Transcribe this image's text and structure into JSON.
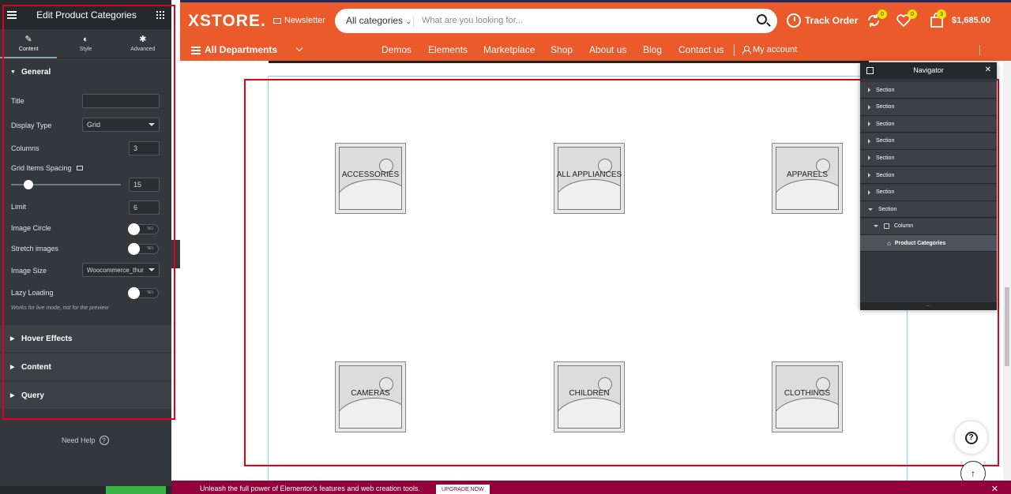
{
  "editor": {
    "title": "Edit Product Categories",
    "tabs": [
      {
        "label": "Content",
        "icon": "pencil-icon"
      },
      {
        "label": "Style",
        "icon": "half-circle-icon"
      },
      {
        "label": "Advanced",
        "icon": "gear-icon"
      }
    ],
    "section_general": "General",
    "controls": {
      "title_label": "Title",
      "title_value": "",
      "display_type_label": "Display Type",
      "display_type_value": "Grid",
      "columns_label": "Columns",
      "columns_value": "3",
      "spacing_label": "Grid Items Spacing",
      "spacing_value": "15",
      "limit_label": "Limit",
      "limit_value": "6",
      "image_circle_label": "Image Circle",
      "stretch_label": "Stretch images",
      "image_size_label": "Image Size",
      "image_size_value": "Woocommerce_thur",
      "lazy_label": "Lazy Loading",
      "lazy_hint": "Works for live mode, not for the preview",
      "toggle_off": "NO"
    },
    "sections_closed": [
      "Hover Effects",
      "Content",
      "Query"
    ],
    "need_help": "Need Help"
  },
  "site": {
    "logo": "XSTORE.",
    "newsletter": "Newsletter",
    "search_category": "All categories",
    "search_placeholder": "What are you looking for...",
    "track_order": "Track Order",
    "compare_count": "0",
    "wishlist_count": "0",
    "cart_count": "3",
    "cart_total": "$1,685.00",
    "all_departments": "All Departments",
    "menu": [
      "Demos",
      "Elements",
      "Marketplace",
      "Shop",
      "About us",
      "Blog",
      "Contact us"
    ],
    "my_account": "My account"
  },
  "categories": [
    "ACCESSORIES",
    "ALL APPLIANCES",
    "APPARELS",
    "CAMERAS",
    "CHILDREN",
    "CLOTHINGS"
  ],
  "navigator": {
    "title": "Navigator",
    "rows": [
      {
        "label": "Section"
      },
      {
        "label": "Section"
      },
      {
        "label": "Section"
      },
      {
        "label": "Section"
      },
      {
        "label": "Section"
      },
      {
        "label": "Section"
      },
      {
        "label": "Section"
      },
      {
        "label": "Section"
      },
      {
        "label": "Column"
      },
      {
        "label": "Product Categories"
      }
    ],
    "footer": "..."
  },
  "promo": {
    "text": "Unleash the full power of Elementor's features and web creation tools.",
    "button": "UPGRADE NOW"
  },
  "colors": {
    "brand": "#ea5a2b",
    "panel": "#34383c",
    "highlight": "#e4001b",
    "promo": "#93003c"
  }
}
